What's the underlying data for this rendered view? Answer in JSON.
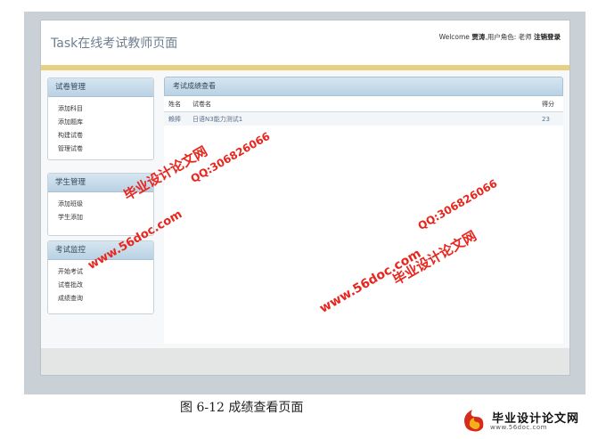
{
  "header": {
    "title": "Task在线考试教师页面",
    "welcome": "Welcome",
    "username": "贾涛",
    "role_label": ",用户角色: 老师",
    "logout": "注销登录"
  },
  "sidebar": {
    "panels": [
      {
        "title": "试卷管理",
        "items": [
          "添加科目",
          "添加题库",
          "构建试卷",
          "管理试卷"
        ]
      },
      {
        "title": "学生管理",
        "items": [
          "添加班级",
          "学生添加"
        ]
      },
      {
        "title": "考试监控",
        "items": [
          "开始考试",
          "试卷批改",
          "成绩查询"
        ]
      }
    ]
  },
  "main": {
    "title": "考试成绩查看",
    "columns": [
      "姓名",
      "试卷名",
      "得分"
    ],
    "rows": [
      {
        "name": "賴捧",
        "paper": "日语N3能力测试1",
        "score": "23"
      }
    ]
  },
  "caption": "图 6-12  成绩查看页面",
  "watermarks": {
    "site": "毕业设计论文网",
    "url": "www.56doc.com",
    "qq": "QQ:306826066"
  },
  "logo": {
    "text": "毕业设计论文网",
    "url": "www.56doc.com"
  },
  "colors": {
    "accent_bar": "#e7d181",
    "panel_header": "#c6dcea",
    "watermark": "#e8261d"
  }
}
